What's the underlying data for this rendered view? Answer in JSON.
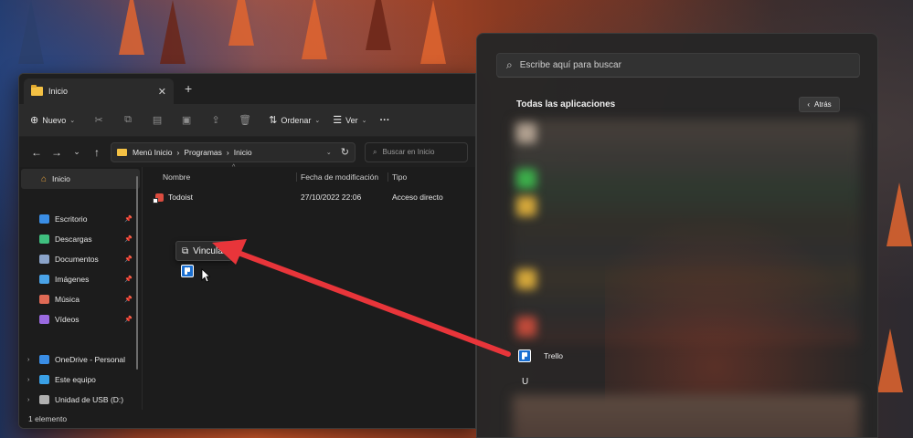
{
  "explorer": {
    "tab_title": "Inicio",
    "tab_close": "✕",
    "new_tab": "+",
    "toolbar": {
      "new_label": "Nuevo",
      "sort_label": "Ordenar",
      "view_label": "Ver",
      "more_label": "···"
    },
    "address": {
      "crumbs": [
        "Menú Inicio",
        "Programas",
        "Inicio"
      ],
      "separator": "›",
      "search_placeholder": "Buscar en Inicio"
    },
    "sidebar": {
      "home": "Inicio",
      "pinned": [
        {
          "label": "Escritorio",
          "icon": "desktop-icon",
          "color": "#3a8ee6"
        },
        {
          "label": "Descargas",
          "icon": "download-icon",
          "color": "#3fbf7f"
        },
        {
          "label": "Documentos",
          "icon": "documents-icon",
          "color": "#8aa3c9"
        },
        {
          "label": "Imágenes",
          "icon": "pictures-icon",
          "color": "#4aa3e8"
        },
        {
          "label": "Música",
          "icon": "music-icon",
          "color": "#e06a55"
        },
        {
          "label": "Vídeos",
          "icon": "videos-icon",
          "color": "#9a6ae0"
        }
      ],
      "locations": [
        {
          "label": "OneDrive - Personal",
          "icon": "onedrive-icon",
          "color": "#3a8ee6"
        },
        {
          "label": "Este equipo",
          "icon": "computer-icon",
          "color": "#3aa0e6"
        },
        {
          "label": "Unidad de USB (D:)",
          "icon": "usb-drive-icon",
          "color": "#b0b0b0"
        }
      ]
    },
    "columns": {
      "name": "Nombre",
      "date": "Fecha de modificación",
      "type": "Tipo"
    },
    "files": [
      {
        "name": "Todoist",
        "date": "27/10/2022 22:06",
        "type": "Acceso directo"
      }
    ],
    "drag_tooltip": "Vincular",
    "status": "1 elemento"
  },
  "startmenu": {
    "search_placeholder": "Escribe aquí para buscar",
    "heading": "Todas las aplicaciones",
    "back_label": "Atrás",
    "trello_label": "Trello",
    "letter_u": "U"
  },
  "colors": {
    "arrow": "#e8353a",
    "trello": "#1b6fd0",
    "folder": "#f4c144"
  }
}
